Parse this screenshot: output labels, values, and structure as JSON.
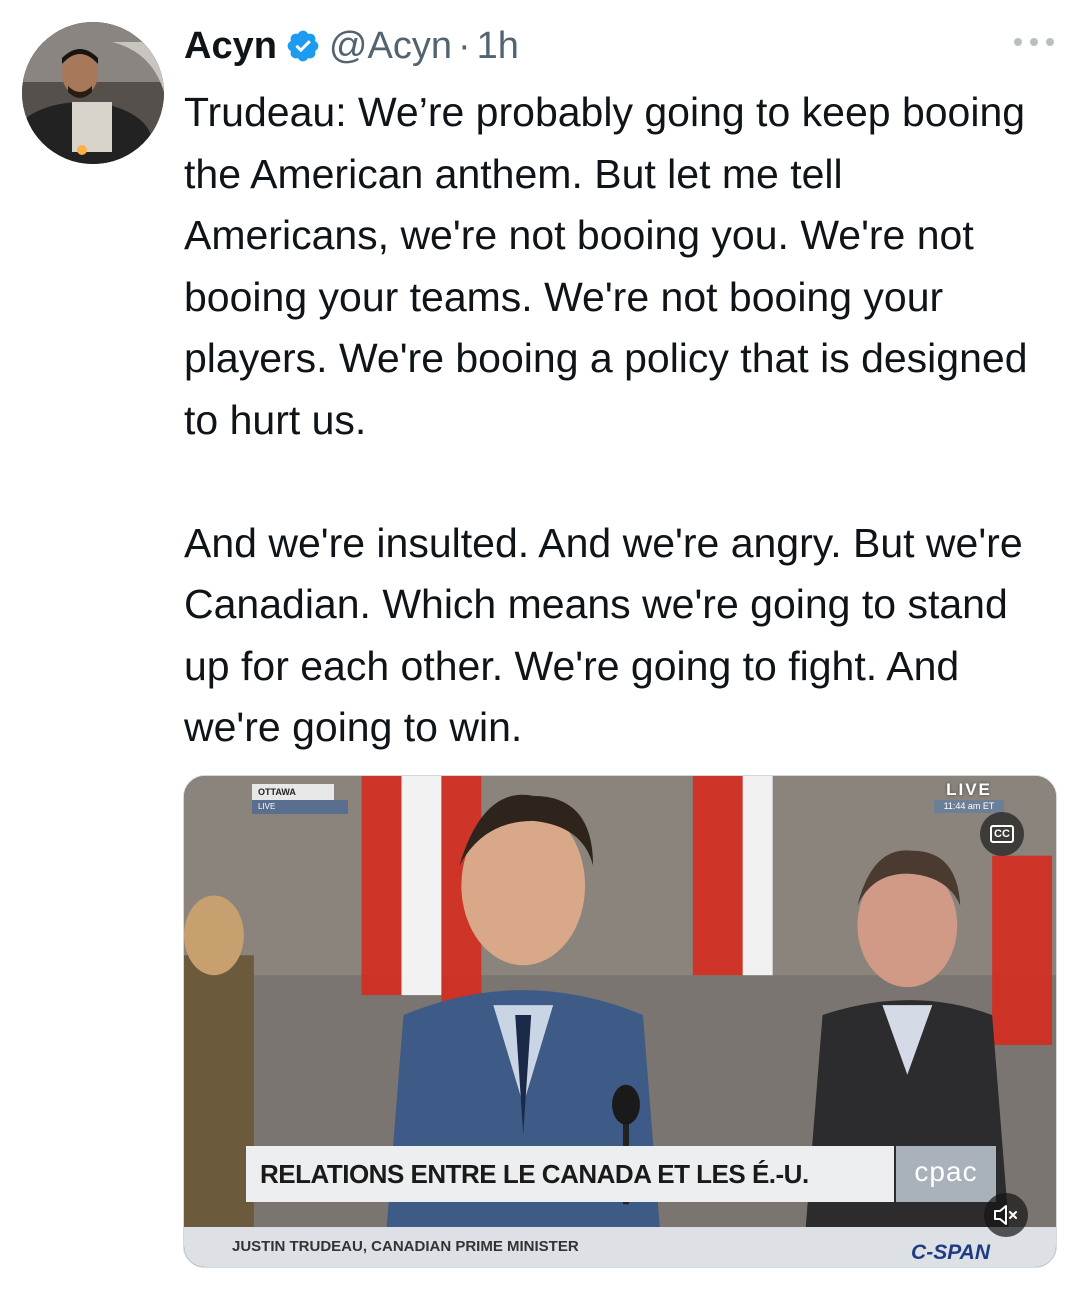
{
  "author": {
    "name": "Acyn",
    "handle": "@Acyn",
    "separator": "·",
    "time": "1h",
    "verified": true
  },
  "tweet": {
    "text": "Trudeau: We’re probably going to keep booing the American anthem. But let me tell Americans, we're not booing you. We're not booing your teams. We're not booing your players. We're booing a policy that is designed to hurt us.\n\nAnd we're insulted. And we're angry. But we're Canadian. Which means we're going to stand up for each other. We're going to fight. And we're going to win."
  },
  "media": {
    "location_label": "OTTAWA",
    "location_sub": "LIVE",
    "live_label": "LIVE",
    "live_time": "11:44 am ET",
    "cc_label": "CC",
    "headline": "RELATIONS ENTRE LE CANADA ET LES É.-U.",
    "network_logo": "cpac",
    "caption": "JUSTIN TRUDEAU, CANADIAN PRIME MINISTER",
    "broadcaster": "C-SPAN"
  },
  "colors": {
    "text": "#0f1419",
    "secondary": "#536471",
    "verified_blue": "#1d9bf0",
    "flag_red": "#d52b1e"
  },
  "icons": [
    "verified-badge-icon",
    "more-icon",
    "closed-captions-icon",
    "muted-speaker-icon"
  ]
}
